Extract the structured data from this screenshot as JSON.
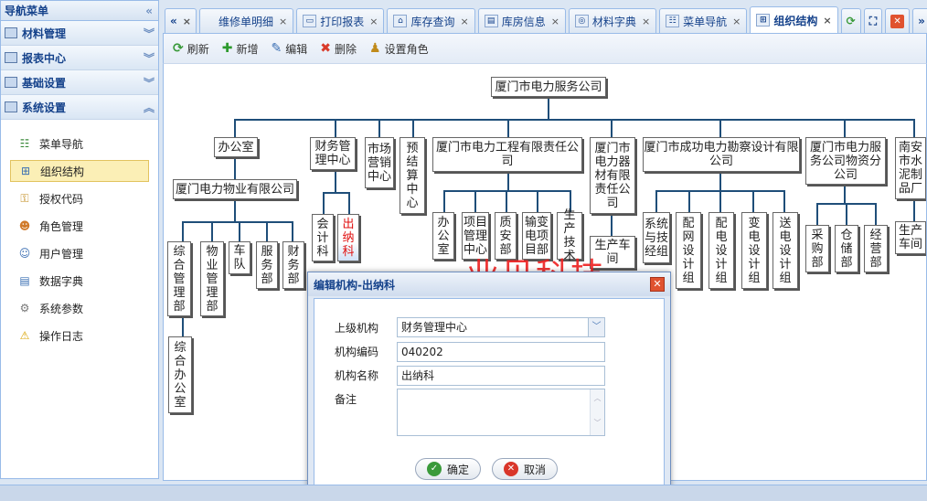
{
  "sidebar": {
    "title": "导航菜单",
    "collapse_icon": "double-chevron-left-icon",
    "groups": [
      {
        "label": "材料管理"
      },
      {
        "label": "报表中心"
      },
      {
        "label": "基础设置"
      },
      {
        "label": "系统设置"
      }
    ],
    "items": [
      {
        "label": "菜单导航",
        "icon": "menu-tree-icon"
      },
      {
        "label": "组织结构",
        "icon": "org-structure-icon"
      },
      {
        "label": "授权代码",
        "icon": "key-icon"
      },
      {
        "label": "角色管理",
        "icon": "users-icon"
      },
      {
        "label": "用户管理",
        "icon": "user-icon"
      },
      {
        "label": "数据字典",
        "icon": "book-icon"
      },
      {
        "label": "系统参数",
        "icon": "gear-icon"
      },
      {
        "label": "操作日志",
        "icon": "warning-icon"
      }
    ]
  },
  "tabs": [
    {
      "label": "维修单明细"
    },
    {
      "label": "打印报表"
    },
    {
      "label": "库存查询"
    },
    {
      "label": "库房信息"
    },
    {
      "label": "材料字典"
    },
    {
      "label": "菜单导航"
    },
    {
      "label": "组织结构"
    }
  ],
  "toolbar": {
    "refresh": "刷新",
    "add": "新增",
    "edit": "编辑",
    "delete": "删除",
    "set_role": "设置角色"
  },
  "org": {
    "root": "厦门市电力服务公司",
    "n1": "办公室",
    "n1a": "厦门电力物业有限公司",
    "n1a1": "综合管理部",
    "n1a1a": "综合办公室",
    "n1a2": "物业管理部",
    "n1a3": "车队",
    "n1a4": "服务部",
    "n1a5": "财务部",
    "n2": "财务管理中心",
    "n2a": "会计科",
    "n2b": "出纳科",
    "n3": "市场营销中心",
    "n4": "预结算中心",
    "n5": "厦门市电力工程有限责任公司",
    "n5a": "办公室",
    "n5b": "项目管理中心",
    "n5c": "质安部",
    "n5d": "输变电项目部",
    "n5e": "生产技术",
    "n6": "厦门市电力器材有限责任公司",
    "n6a": "生产车间",
    "n7": "厦门市成功电力勘察设计有限公司",
    "n7a": "系统与技经组",
    "n7b": "配网设计组",
    "n7c": "配电设计组",
    "n7d": "变电设计组",
    "n7e": "送电设计组",
    "n8": "厦门市电力服务公司物资分公司",
    "n8a": "采购部",
    "n8b": "仓储部",
    "n8c": "经营部",
    "n9": "南安市水泥制品厂",
    "n9a": "生产车间"
  },
  "watermark": "业贝科技",
  "dialog": {
    "title": "编辑机构-出纳科",
    "parent_label": "上级机构",
    "parent_value": "财务管理中心",
    "code_label": "机构编码",
    "code_value": "040202",
    "name_label": "机构名称",
    "name_value": "出纳科",
    "remark_label": "备注",
    "ok": "确定",
    "cancel": "取消"
  }
}
